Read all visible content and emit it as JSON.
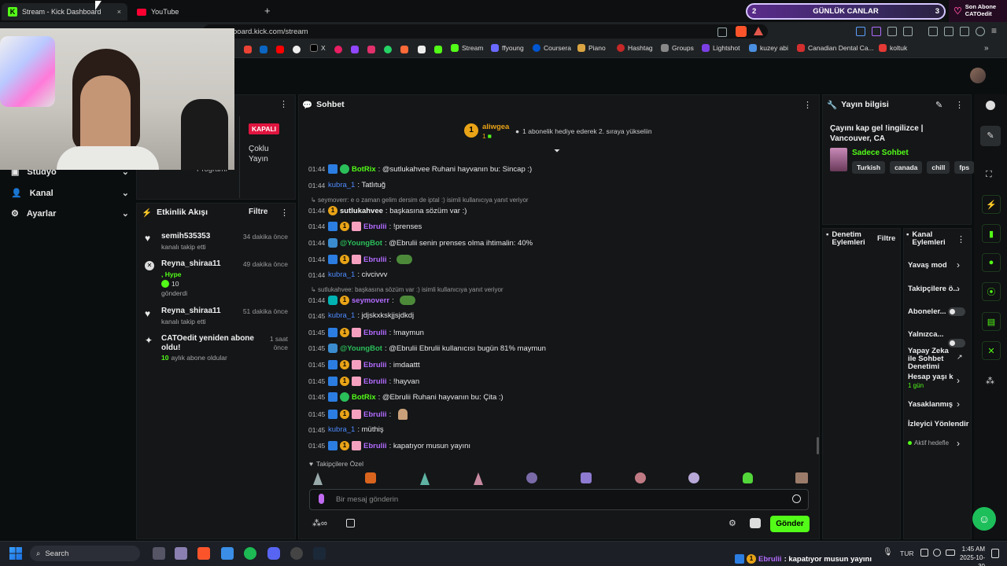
{
  "browser": {
    "tabs": [
      {
        "label": "Stream - Kick Dashboard"
      },
      {
        "label": "YouTube"
      }
    ],
    "new_tab": "+",
    "close_tab": "×",
    "url": "board.kick.com/stream",
    "bookmarks": [
      "X",
      "Stream",
      "ffyoung",
      "Coursera",
      "Piano",
      "Hashtag",
      "Groups",
      "Lightshot",
      "kuzey abi",
      "Canadian Dental Ca...",
      "koltuk"
    ]
  },
  "overlay": {
    "goal_left": "2",
    "goal_label": "GÜNLÜK CANLAR",
    "goal_right": "3",
    "last_sub_title": "Son Abone",
    "last_sub_name": "CATOedit"
  },
  "sidebar": {
    "items": [
      {
        "label": "Stüdyo"
      },
      {
        "label": "Kanal"
      },
      {
        "label": "Ayarlar"
      }
    ]
  },
  "stream_panel": {
    "status": "KAPALI",
    "multi_label_1": "Çoklu",
    "multi_label_2": "Yayın",
    "program_label": "Programı"
  },
  "activity": {
    "title": "Etkinlik Akışı",
    "filter": "Filtre",
    "events": [
      {
        "name": "semih535353",
        "sub": "kanalı takip etti",
        "time": "34 dakika önce"
      },
      {
        "name": "Reyna_shiraa11",
        "sub": ", Hype",
        "sub2": "10",
        "sub3": "gönderdi",
        "time": "49 dakika önce"
      },
      {
        "name": "Reyna_shiraa11",
        "sub": "kanalı takip etti",
        "time": "51 dakika önce"
      },
      {
        "name": "CATOedit yeniden abone oldu!",
        "sub_accent": "10",
        "sub": "aylık abone oldular",
        "time1": "1 saat",
        "time2": "önce"
      }
    ]
  },
  "chat": {
    "title": "Sohbet",
    "pinned_user": "aliwgea",
    "pinned_count": "1",
    "pinned_text": "1 abonelik hediye ederek 2. sıraya yükseliin",
    "messages": [
      {
        "time": "01:44",
        "user": "BotRix",
        "text": ": @sutlukahvee Ruhani hayvanın bu: Sincap :)"
      },
      {
        "time": "01:44",
        "user": "kubra_1",
        "text": ": Tatlıtuğ"
      },
      {
        "reply": "seymoverr: e o zaman gelim dersim de iptal :) isimli kullanıcıya yanıt veriyor"
      },
      {
        "time": "01:44",
        "user": "sutlukahvee",
        "text": ": başkasına sözüm var :)"
      },
      {
        "time": "01:44",
        "user": "Ebrulii",
        "text": ": !prenses"
      },
      {
        "time": "01:44",
        "user": "@YoungBot",
        "text": ": @Ebrulii senin prenses olma ihtimalin: 40%"
      },
      {
        "time": "01:44",
        "user": "Ebrulii",
        "text": ":"
      },
      {
        "time": "01:44",
        "user": "kubra_1",
        "text": ": civcivvv"
      },
      {
        "reply": "sutlukahvee: başkasına sözüm var :) isimli kullanıcıya yanıt veriyor"
      },
      {
        "time": "01:44",
        "user": "seymoverr",
        "text": ":"
      },
      {
        "time": "01:45",
        "user": "kubra_1",
        "text": ": jdjskxkskjjsjdkdj"
      },
      {
        "time": "01:45",
        "user": "Ebrulii",
        "text": ": !maymun"
      },
      {
        "time": "01:45",
        "user": "@YoungBot",
        "text": ": @Ebrulii Ebrulii kullanıcısı bugün 81% maymun"
      },
      {
        "time": "01:45",
        "user": "Ebrulii",
        "text": ": imdaattt"
      },
      {
        "time": "01:45",
        "user": "Ebrulii",
        "text": ": !hayvan"
      },
      {
        "time": "01:45",
        "user": "BotRix",
        "text": ": @Ebrulii Ruhani hayvanın bu: Çita :)"
      },
      {
        "time": "01:45",
        "user": "Ebrulii",
        "text": ":"
      },
      {
        "time": "01:45",
        "user": "kubra_1",
        "text": ": müthiş"
      },
      {
        "time": "01:45",
        "user": "Ebrulii",
        "text": ": kapatıyor musun yayını"
      }
    ],
    "follower_only": "Takipçilere Özel",
    "input_placeholder": "Bir mesaj gönderin",
    "send": "Gönder"
  },
  "stream_info": {
    "title": "Yayın bilgisi",
    "stream_title": "Çayını kap gel !ingilizce | Vancouver, CA",
    "category": "Sadece Sohbet",
    "tags": [
      "Turkish",
      "canada",
      "chill",
      "fps"
    ]
  },
  "mod": {
    "title_1": "Denetim",
    "title_2": "Eylemleri",
    "filter": "Filtre",
    "channel_title_1": "Kanal",
    "channel_title_2": "Eylemleri",
    "rows": [
      {
        "label": "Yavaş mod"
      },
      {
        "label": "Takipçilere ö..."
      },
      {
        "label": "Aboneler..."
      },
      {
        "label": "Yalnızca..."
      },
      {
        "label": "Yapay Zeka ile Sohbet Denetimi"
      },
      {
        "label": "Hesap yaşı k...",
        "sub": "1 gün"
      },
      {
        "label": "Yasaklanmış"
      },
      {
        "label": "İzleyici Yönlendir"
      },
      {
        "label": "Aktif hedefle"
      }
    ]
  },
  "taskbar": {
    "search": "Search",
    "ticker_user": "Ebrulii",
    "ticker_text": ": kapatıyor musun yayını",
    "lang": "TUR",
    "time": "1:45 AM",
    "date": "2025-10-30"
  },
  "colors": {
    "kick_green": "#53fc18",
    "purple_user": "#b36bff",
    "blue_user": "#4f8bff"
  }
}
